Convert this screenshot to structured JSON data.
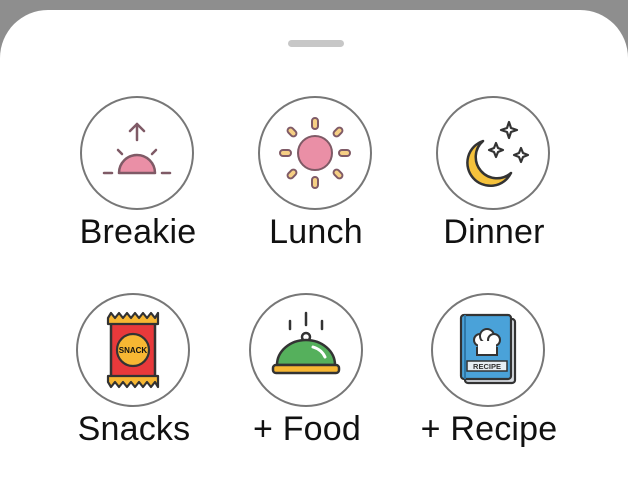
{
  "sheet": {
    "items": [
      {
        "label": "Breakie",
        "icon": "sunrise-icon"
      },
      {
        "label": "Lunch",
        "icon": "sun-icon"
      },
      {
        "label": "Dinner",
        "icon": "moon-stars-icon"
      },
      {
        "label": "Snacks",
        "icon": "snack-bag-icon"
      },
      {
        "label": "+ Food",
        "icon": "food-cloche-icon"
      },
      {
        "label": "+ Recipe",
        "icon": "recipe-book-icon"
      }
    ],
    "snack_bag_text": "SNACK",
    "recipe_book_text": "RECIPE"
  },
  "colors": {
    "pink": "#ea8fa6",
    "sun_ray": "#e6b35f",
    "moon": "#f5c23c",
    "snack_red": "#e8393b",
    "snack_yellow": "#f7b733",
    "cloche_green": "#55b05c",
    "book_blue": "#4aa2d9"
  }
}
